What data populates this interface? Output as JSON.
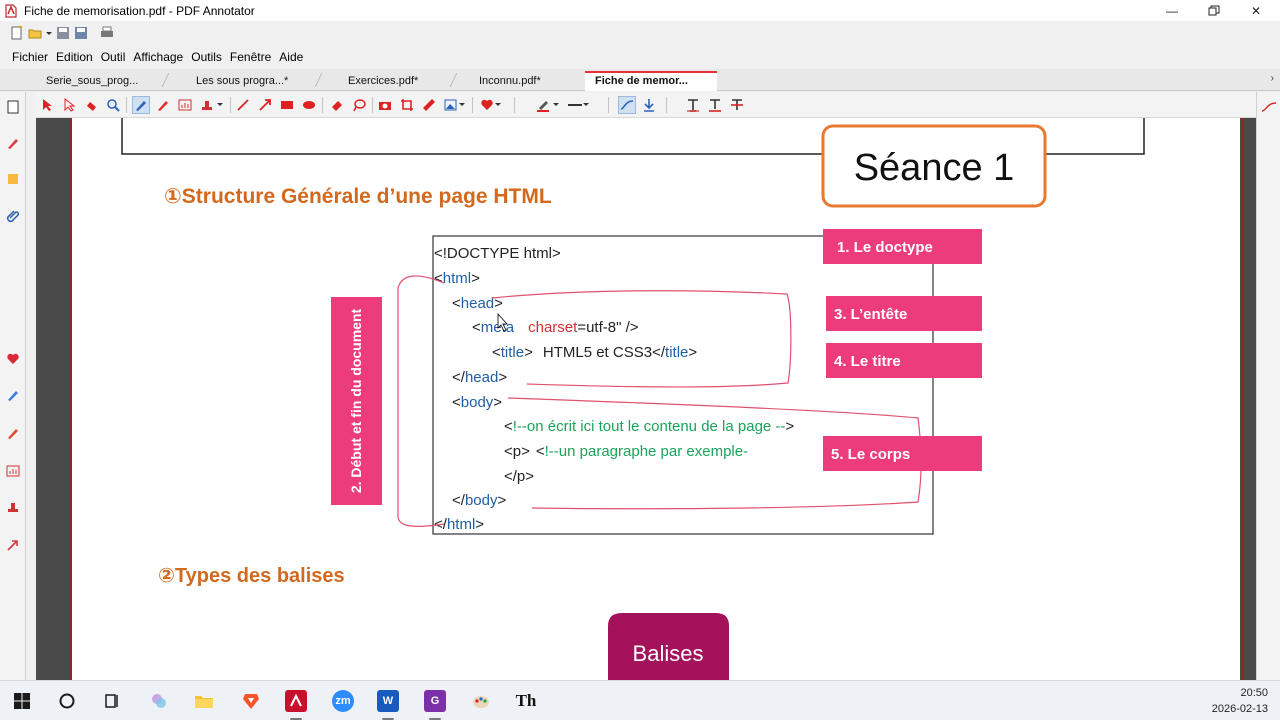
{
  "window": {
    "title": "Fiche de memorisation.pdf - PDF Annotator"
  },
  "menu": [
    "Fichier",
    "Edition",
    "Outil",
    "Affichage",
    "Outils",
    "Fenêtre",
    "Aide"
  ],
  "tabs": [
    {
      "label": "Serie_sous_prog...",
      "active": false
    },
    {
      "label": "Les sous progra...*",
      "active": false
    },
    {
      "label": "Exercices.pdf*",
      "active": false
    },
    {
      "label": "Inconnu.pdf*",
      "active": false
    },
    {
      "label": "Fiche de memor...",
      "active": true
    }
  ],
  "document": {
    "seance": "Séance 1",
    "section1_title": "①Structure Générale d’une page HTML",
    "code": {
      "doctype": "<!DOCTYPE html>",
      "html_open_lt": "<",
      "html_tag": "html",
      "html_open_gt": ">",
      "head_open_lt": "<",
      "head_tag": "head",
      "head_open_gt": ">",
      "meta_lt": "<",
      "meta_tag": "meta",
      "meta_attr": "charset",
      "meta_val": "=utf-8\" />",
      "title_lt": "<",
      "title_tag": "title",
      "title_gt": ">",
      "title_text": "HTML5 et CSS3",
      "title_close_lt": "</",
      "title_close_tag": "title",
      "title_close_gt": ">",
      "head_close_lt": "</",
      "head_close_tag": "head",
      "head_close_gt": ">",
      "body_open_lt": "<",
      "body_tag": "body",
      "body_open_gt": ">",
      "comment1_lt": "<",
      "comment1": "!--on écrit ici tout le contenu de la page --",
      "comment1_gt": ">",
      "p_open": "<p>",
      "comment2_lt": "<",
      "comment2": "!--un paragraphe par exemple-",
      "p_close": "</p>",
      "body_close_lt": "</",
      "body_close_tag": "body",
      "body_close_gt": ">",
      "html_close_lt": "</",
      "html_close_tag": "html",
      "html_close_gt": ">"
    },
    "labels": {
      "doctype": "1. Le doctype",
      "debut_fin": "2. Début et fin du document",
      "entete": "3. L’entête",
      "titre": "4. Le titre",
      "corps": "5. Le corps"
    },
    "section2_title": "②Types des balises",
    "balises": "Balises"
  },
  "colors": {
    "orange_title": "#d2691e",
    "pink_label": "#ec3c7b",
    "magenta_box": "#a3125a",
    "seance_border": "#e8792e",
    "code_blue": "#1f5fa8",
    "code_red": "#d03030",
    "code_green": "#1aa35a",
    "annotation_line": "#e05070"
  },
  "taskbar": {
    "time": "20:50",
    "date": "2026-02-13"
  }
}
